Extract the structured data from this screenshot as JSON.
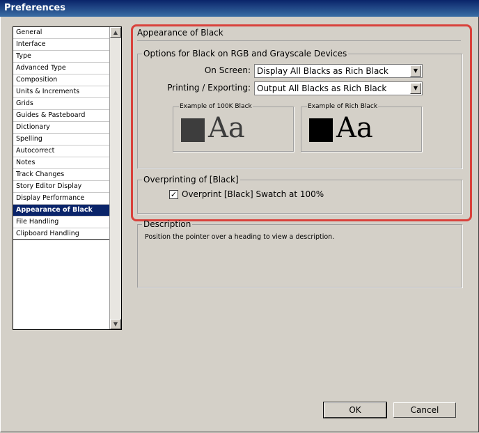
{
  "window": {
    "title": "Preferences"
  },
  "categories": [
    "General",
    "Interface",
    "Type",
    "Advanced Type",
    "Composition",
    "Units & Increments",
    "Grids",
    "Guides & Pasteboard",
    "Dictionary",
    "Spelling",
    "Autocorrect",
    "Notes",
    "Track Changes",
    "Story Editor Display",
    "Display Performance",
    "Appearance of Black",
    "File Handling",
    "Clipboard Handling"
  ],
  "selected_category": "Appearance of Black",
  "panel": {
    "title": "Appearance of Black",
    "options_group": {
      "legend": "Options for Black on RGB and Grayscale Devices",
      "on_screen_label": "On Screen:",
      "on_screen_value": "Display All Blacks as Rich Black",
      "printing_label": "Printing / Exporting:",
      "printing_value": "Output All Blacks as Rich Black",
      "example_100k_label": "Example of 100K Black",
      "example_rich_label": "Example of Rich Black",
      "sample_text": "Aa",
      "color_100k": "#3d3d3d",
      "color_rich": "#000000"
    },
    "overprint_group": {
      "legend": "Overprinting of [Black]",
      "checkbox_label": "Overprint [Black] Swatch at 100%",
      "checked": true,
      "check_glyph": "✓"
    }
  },
  "description": {
    "legend": "Description",
    "text": "Position the pointer over a heading to view a description."
  },
  "buttons": {
    "ok": "OK",
    "cancel": "Cancel"
  },
  "scroll_glyphs": {
    "up": "▲",
    "down": "▼",
    "combo": "▼"
  }
}
